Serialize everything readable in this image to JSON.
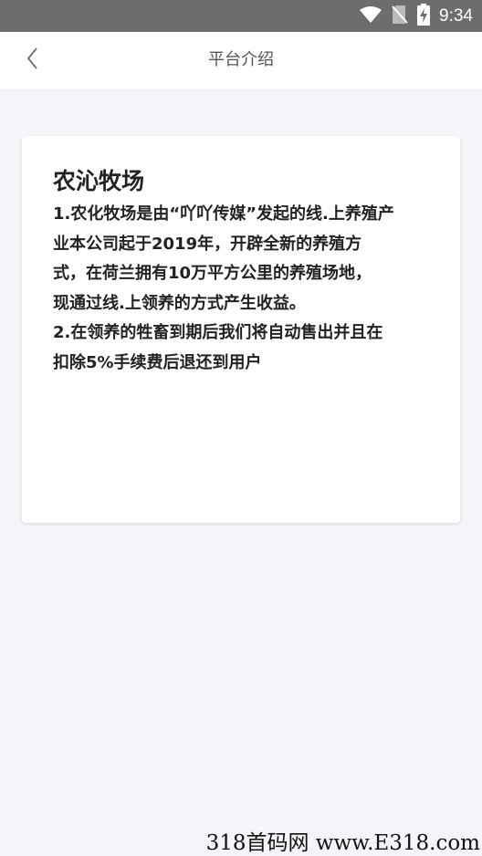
{
  "status_bar": {
    "time": "9:34",
    "icons": [
      "wifi-icon",
      "no-sim-icon",
      "battery-charging-icon"
    ]
  },
  "header": {
    "title": "平台介绍",
    "back_icon": "chevron-left-icon"
  },
  "card": {
    "title": "农沁牧场",
    "body": "1.农化牧场是由“吖吖传媒”发起的线.上养殖产\n业本公司起于2019年，开辟全新的养殖方\n式，在荷兰拥有10万平方公里的养殖场地，\n现通过线.上领养的方式产生收益。\n2.在领养的牲畜到期后我们将自动售出并且在\n扣除5%手续费后退还到用户"
  },
  "watermark": "318首码网 www.E318.com"
}
